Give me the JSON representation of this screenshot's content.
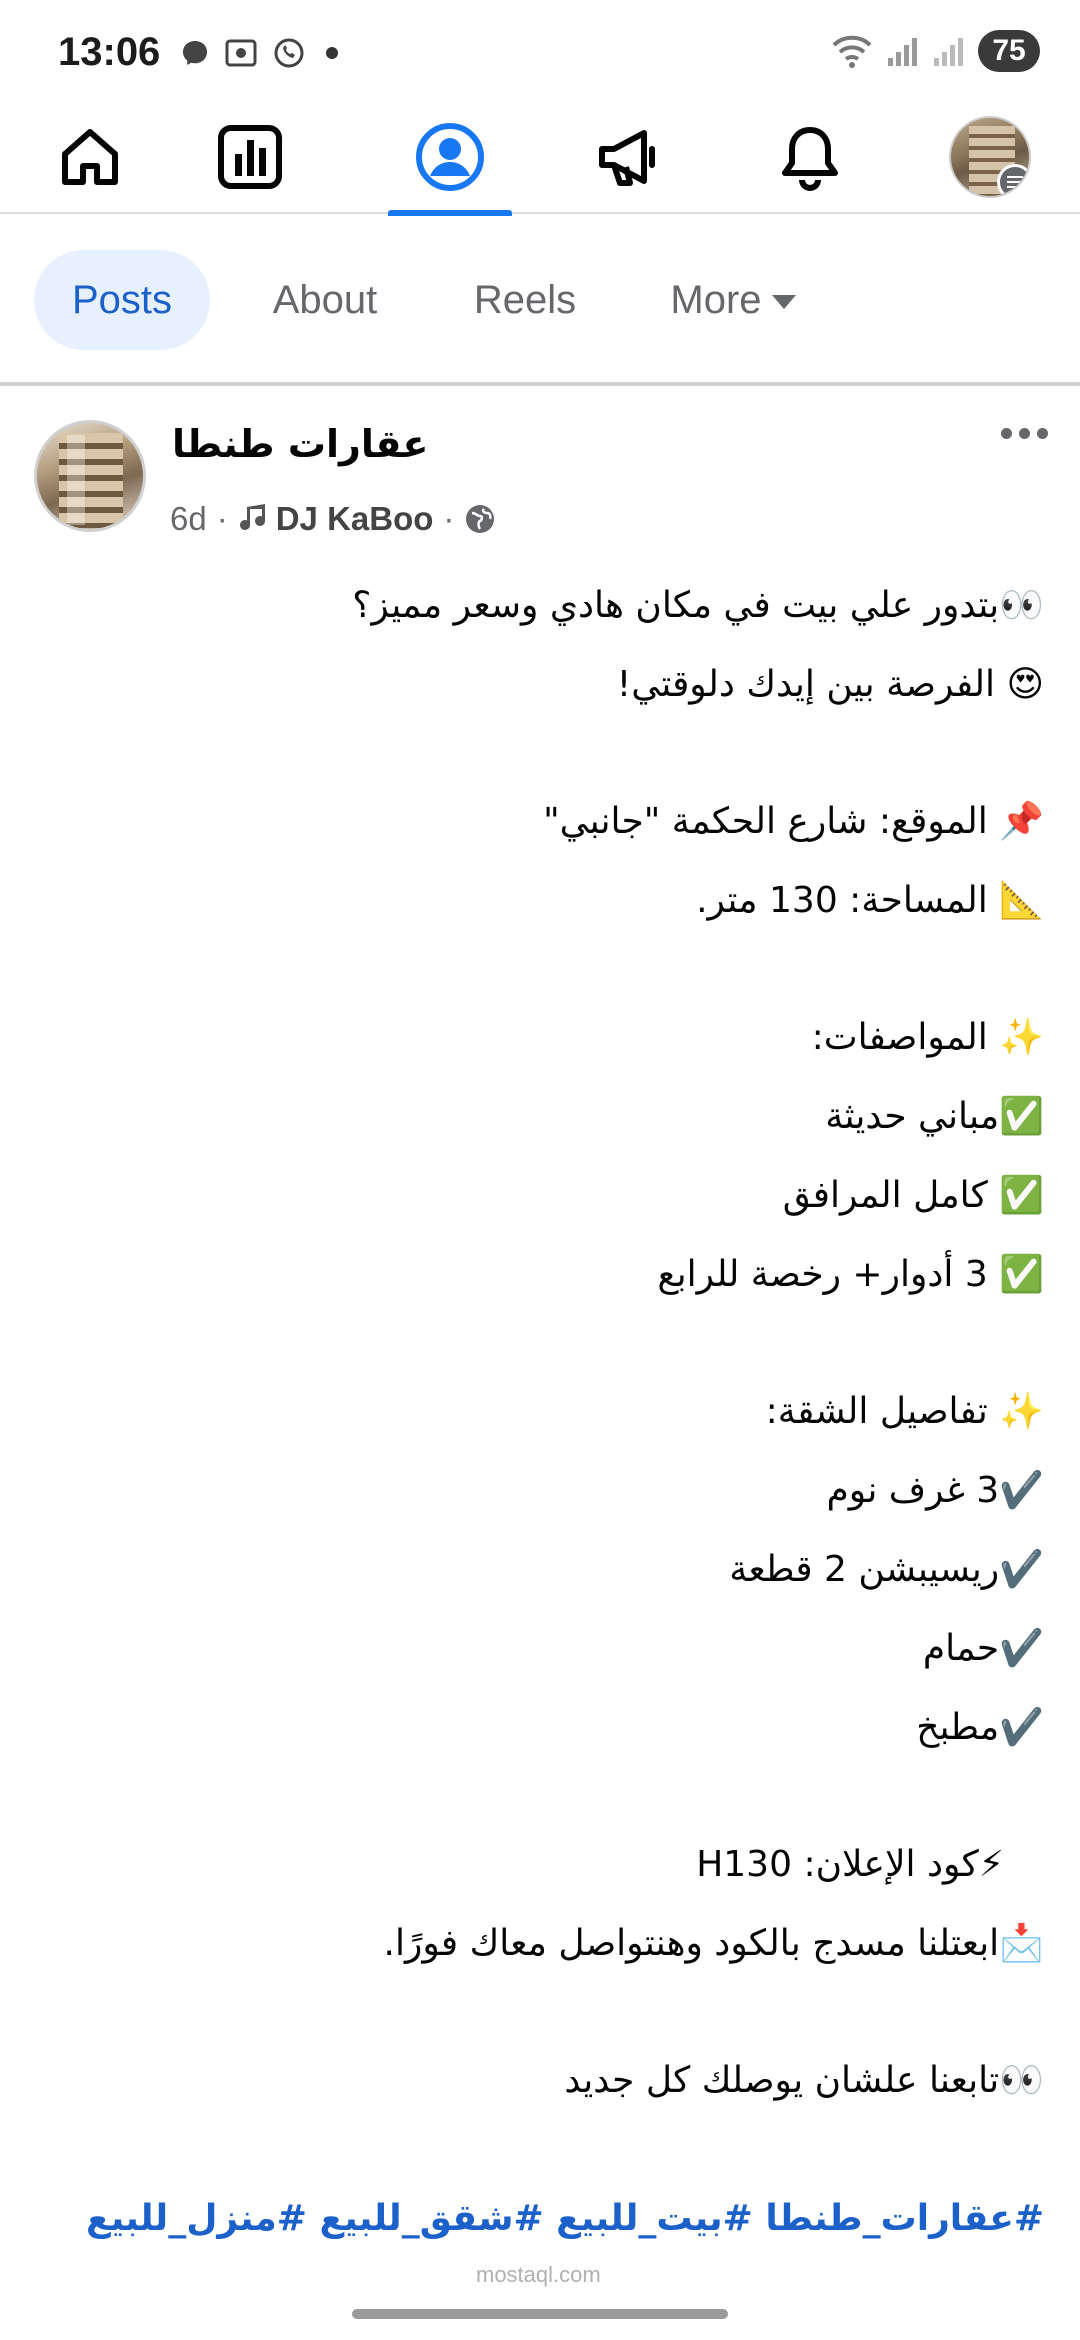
{
  "status_bar": {
    "time": "13:06",
    "battery": "75"
  },
  "top_nav": {
    "items": [
      {
        "name": "home",
        "icon": "home-icon"
      },
      {
        "name": "dashboard",
        "icon": "bar-chart-icon"
      },
      {
        "name": "profile",
        "icon": "profile-icon",
        "active": true
      },
      {
        "name": "ads",
        "icon": "megaphone-icon"
      },
      {
        "name": "notifications",
        "icon": "bell-icon"
      },
      {
        "name": "menu",
        "icon": "avatar-menu-icon"
      }
    ],
    "accent": "#1877f2"
  },
  "tabs": {
    "posts": "Posts",
    "about": "About",
    "reels": "Reels",
    "more": "More"
  },
  "post": {
    "page_name": "عقارات طنطا",
    "time": "6d",
    "music": "DJ KaBoo",
    "lines": {
      "l1": "👀بتدور علي بيت في مكان هادي وسعر مميز؟",
      "l2": "😍 الفرصة بين إيدك دلوقتي!",
      "l3": "📌 الموقع: شارع الحكمة  \"جانبي\"",
      "l4": "📐 المساحة: 130 متر.",
      "l5": "✨ المواصفات:",
      "l6": "✅مباني حديثة",
      "l7": "✅ كامل المرافق",
      "l8": "✅ 3 أدوار+ رخصة للرابع",
      "l9": "✨ تفاصيل الشقة:",
      "l10": "✔️3 غرف نوم",
      "l11": "✔️ريسيبشن 2 قطعة",
      "l12": "✔️حمام",
      "l13": "✔️مطبخ",
      "l14": "⚡كود الإعلان: H130",
      "l15": "📩ابعتلنا مسدج بالكود وهنتواصل معاك فورًا.",
      "l16": "👀تابعنا علشان يوصلك كل جديد"
    },
    "hashtags": "#عقارات_طنطا #بيت_للبيع #شقق_للبيع #منزل_للبيع",
    "link_color": "#1b61c9"
  },
  "watermark": "mostaql.com"
}
